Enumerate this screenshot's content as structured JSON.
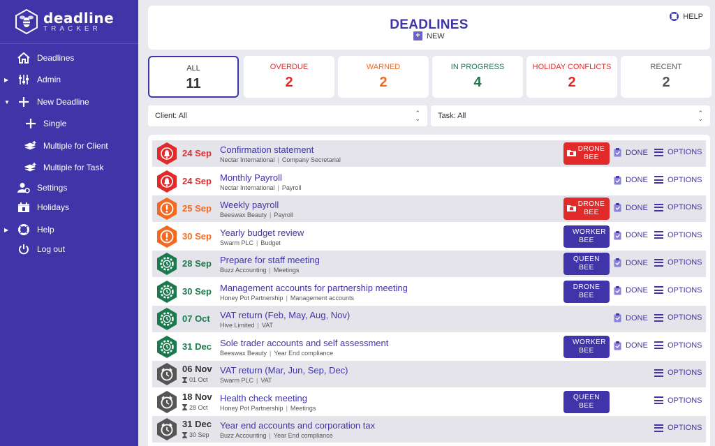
{
  "colors": {
    "brand": "#3f35a8",
    "red": "#e12b2b",
    "orange": "#f26a22",
    "green": "#1a7a4c",
    "grey": "#555555"
  },
  "sidebar": {
    "logo_main": "deadline",
    "logo_sub": "TRACKER",
    "items": [
      {
        "label": "Deadlines",
        "icon": "home-icon"
      },
      {
        "label": "Admin",
        "icon": "sliders-icon"
      },
      {
        "label": "New Deadline",
        "icon": "plus-icon"
      },
      {
        "label": "Single",
        "icon": "plus-icon"
      },
      {
        "label": "Multiple for Client",
        "icon": "layers-add-icon"
      },
      {
        "label": "Multiple for Task",
        "icon": "layers-add-icon"
      },
      {
        "label": "Settings",
        "icon": "user-gear-icon"
      },
      {
        "label": "Holidays",
        "icon": "calendar-icon"
      },
      {
        "label": "Help",
        "icon": "lifebuoy-icon"
      },
      {
        "label": "Log out",
        "icon": "power-icon"
      }
    ]
  },
  "header": {
    "title": "DEADLINES",
    "new_label": "NEW",
    "help_label": "HELP"
  },
  "stats": [
    {
      "label": "ALL",
      "value": "11",
      "color": "#333333"
    },
    {
      "label": "OVERDUE",
      "value": "2",
      "color": "#e12b2b"
    },
    {
      "label": "WARNED",
      "value": "2",
      "color": "#f26a22"
    },
    {
      "label": "IN PROGRESS",
      "value": "4",
      "color": "#1a7a4c"
    },
    {
      "label": "HOLIDAY CONFLICTS",
      "value": "2",
      "color": "#e12b2b"
    },
    {
      "label": "RECENT",
      "value": "2",
      "color": "#555555"
    }
  ],
  "filters": {
    "client": "Client: All",
    "task": "Task: All"
  },
  "actions": {
    "done": "DONE",
    "options": "OPTIONS"
  },
  "rows": [
    {
      "status": "overdue",
      "date": "24 Sep",
      "subdate": "",
      "title": "Confirmation statement",
      "client": "Nectar International",
      "task": "Company Secretarial",
      "bee": "DRONE BEE",
      "bee_style": "red",
      "done": true
    },
    {
      "status": "overdue",
      "date": "24 Sep",
      "subdate": "",
      "title": "Monthly Payroll",
      "client": "Nectar International",
      "task": "Payroll",
      "bee": "",
      "bee_style": "",
      "done": true
    },
    {
      "status": "warned",
      "date": "25 Sep",
      "subdate": "",
      "title": "Weekly payroll",
      "client": "Beeswax Beauty",
      "task": "Payroll",
      "bee": "DRONE BEE",
      "bee_style": "red",
      "done": true
    },
    {
      "status": "warned",
      "date": "30 Sep",
      "subdate": "",
      "title": "Yearly budget review",
      "client": "Swarm PLC",
      "task": "Budget",
      "bee": "WORKER BEE",
      "bee_style": "blue",
      "done": true
    },
    {
      "status": "progress",
      "date": "28 Sep",
      "subdate": "",
      "title": "Prepare for staff meeting",
      "client": "Buzz Accounting",
      "task": "Meetings",
      "bee": "QUEEN BEE",
      "bee_style": "blue",
      "done": true
    },
    {
      "status": "progress",
      "date": "30 Sep",
      "subdate": "",
      "title": "Management accounts for partnership meeting",
      "client": "Honey Pot Partnership",
      "task": "Management accounts",
      "bee": "DRONE BEE",
      "bee_style": "blue",
      "done": true
    },
    {
      "status": "progress",
      "date": "07 Oct",
      "subdate": "",
      "title": "VAT return (Feb, May, Aug, Nov)",
      "client": "Hive Limited",
      "task": "VAT",
      "bee": "",
      "bee_style": "",
      "done": true
    },
    {
      "status": "progress",
      "date": "31 Dec",
      "subdate": "",
      "title": "Sole trader accounts and self assessment",
      "client": "Beeswax Beauty",
      "task": "Year End compliance",
      "bee": "WORKER BEE",
      "bee_style": "blue",
      "done": true
    },
    {
      "status": "future",
      "date": "06 Nov",
      "subdate": "01 Oct",
      "title": "VAT return (Mar, Jun, Sep, Dec)",
      "client": "Swarm PLC",
      "task": "VAT",
      "bee": "",
      "bee_style": "",
      "done": false
    },
    {
      "status": "future",
      "date": "18 Nov",
      "subdate": "28 Oct",
      "title": "Health check meeting",
      "client": "Honey Pot Partnership",
      "task": "Meetings",
      "bee": "QUEEN BEE",
      "bee_style": "blue",
      "done": false
    },
    {
      "status": "future",
      "date": "31 Dec",
      "subdate": "30 Sep",
      "title": "Year end accounts and corporation tax",
      "client": "Buzz Accounting",
      "task": "Year End compliance",
      "bee": "",
      "bee_style": "",
      "done": false
    }
  ]
}
